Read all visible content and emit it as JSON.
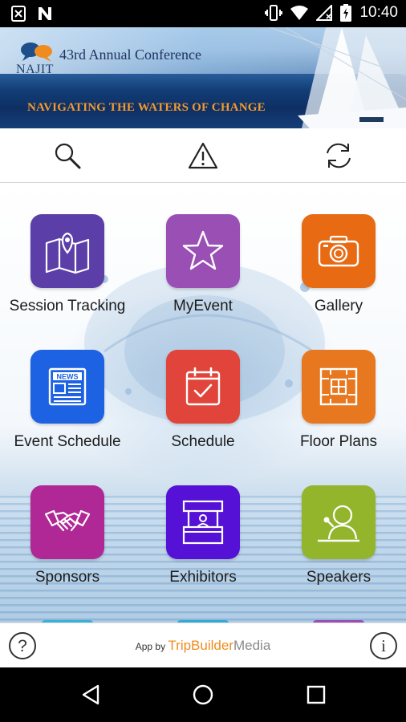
{
  "status_bar": {
    "time": "10:40",
    "left_icons": [
      "close-box-icon",
      "notification-n-icon"
    ],
    "right_icons": [
      "vibrate-icon",
      "wifi-icon",
      "no-signal-icon",
      "battery-charging-icon"
    ]
  },
  "banner": {
    "logo_text": "NAJIT",
    "title": "43rd Annual Conference",
    "tagline": "NAVIGATING THE WATERS OF CHANGE"
  },
  "toolbar": {
    "icons": [
      "search-icon",
      "alert-icon",
      "sync-icon"
    ]
  },
  "tiles": [
    {
      "label": "Session Tracking",
      "icon": "map-pin-icon",
      "color": "#5b3ea8"
    },
    {
      "label": "MyEvent",
      "icon": "star-icon",
      "color": "#9a4fb5"
    },
    {
      "label": "Gallery",
      "icon": "camera-icon",
      "color": "#e86a12"
    },
    {
      "label": "Event Schedule",
      "icon": "newspaper-icon",
      "color": "#1c62e3"
    },
    {
      "label": "Schedule",
      "icon": "calendar-check-icon",
      "color": "#e0443a"
    },
    {
      "label": "Floor Plans",
      "icon": "floor-plan-icon",
      "color": "#e8781f"
    },
    {
      "label": "Sponsors",
      "icon": "handshake-icon",
      "color": "#b02896"
    },
    {
      "label": "Exhibitors",
      "icon": "booth-icon",
      "color": "#5512d6"
    },
    {
      "label": "Speakers",
      "icon": "speaker-icon",
      "color": "#93b52c"
    }
  ],
  "partial_tile_colors": [
    "#3ab0d8",
    "#35a9d6",
    "#9a4fb5"
  ],
  "footer": {
    "help_symbol": "?",
    "info_symbol": "i",
    "credit_prefix": "App by",
    "brand_part1": "TripBuilder",
    "brand_part2": "Media"
  },
  "nav_bar": {
    "icons": [
      "back-icon",
      "home-icon",
      "recents-icon"
    ]
  }
}
